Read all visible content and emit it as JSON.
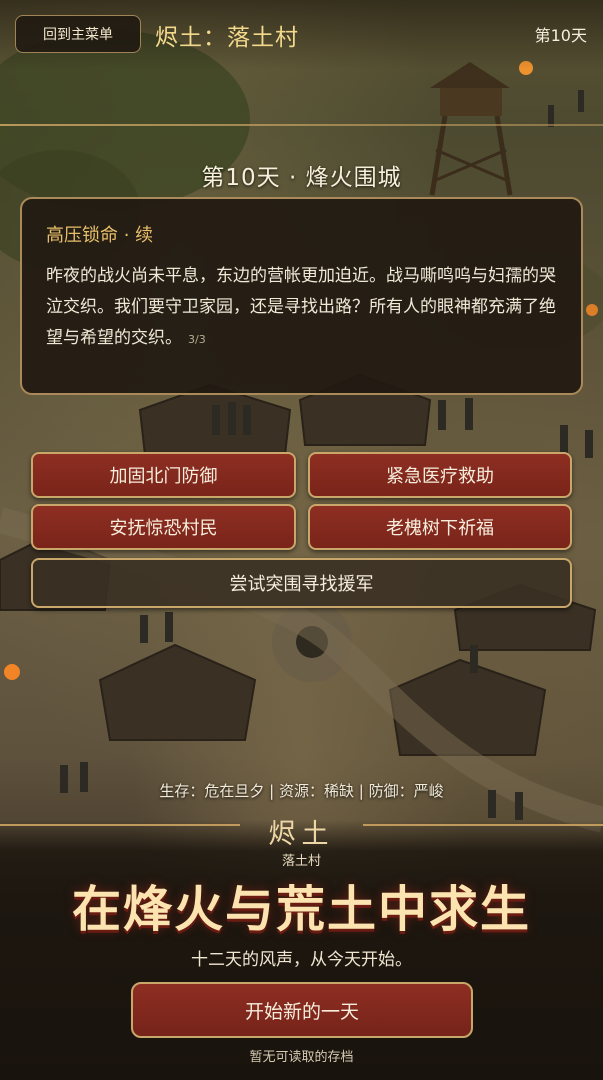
{
  "header": {
    "menu_button": "回到主菜单",
    "location": "烬土：落土村",
    "day": "第10天"
  },
  "event": {
    "day_title": "第10天 · 烽火围城",
    "title": "高压锁命 · 续",
    "body": "昨夜的战火尚未平息，东边的营帐更加迫近。战马嘶鸣呜与妇孺的哭泣交织。我们要守卫家园，还是寻找出路？所有人的眼神都充满了绝望与希望的交织。",
    "page": "3/3"
  },
  "choices": [
    "加固北门防御",
    "紧急医疗救助",
    "安抚惊恐村民",
    "老槐树下祈福",
    "尝试突围寻找援军"
  ],
  "status": "生存：危在旦夕 | 资源：稀缺 | 防御：严峻",
  "title_panel": {
    "logo": "烬土",
    "logo_sub": "落土村",
    "tagline": "在烽火与荒土中求生",
    "subtitle": "十二天的风声，从今天开始。",
    "start_button": "开始新的一天",
    "save_note": "暂无可读取的存档"
  },
  "colors": {
    "accent_gold": "#e8bf6a",
    "button_red": "#8e2e22",
    "border_gold": "#c9a66a",
    "panel_dark": "#211a12"
  }
}
